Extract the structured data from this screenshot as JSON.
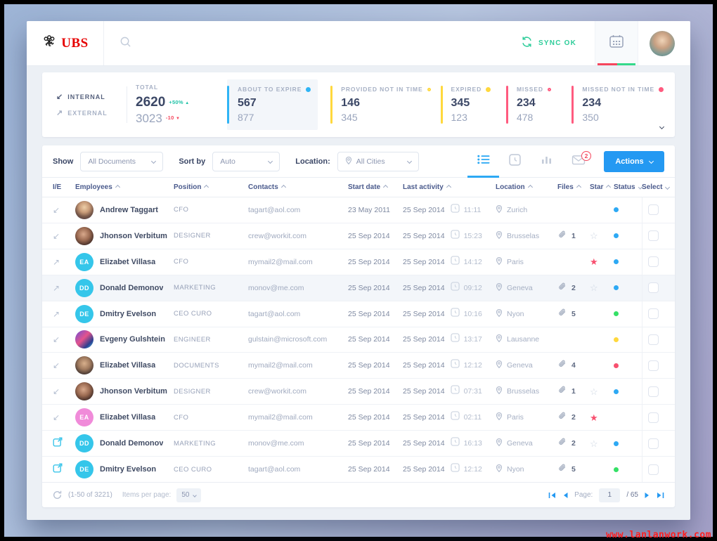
{
  "colors": {
    "accent_blue": "#2499f2",
    "ubs_red": "#e60000",
    "sync_green": "#2ecd9a",
    "star": "#f8506f",
    "status": {
      "blue": "#2da9f4",
      "green": "#35e066",
      "yellow": "#ffd83d",
      "pink": "#f8506f"
    },
    "initials": {
      "cyan": "#35c6ea",
      "pink": "#f08bd9"
    }
  },
  "glyphs": {
    "arrow_in": "↙",
    "arrow_out": "↗",
    "star_filled": "★",
    "star_empty": "☆"
  },
  "header": {
    "brand": "UBS",
    "sync_label": "SYNC OK"
  },
  "stats": {
    "internal_label": "INTERNAL",
    "external_label": "EXTERNAL",
    "total": {
      "label": "TOTAL",
      "internal": "2620",
      "internal_delta": "+50%",
      "external": "3023",
      "external_delta": "-10"
    },
    "cards": [
      {
        "label": "ABOUT TO EXPIRE",
        "internal": "567",
        "external": "877",
        "accent": "#2fb4f5",
        "dot": "filled",
        "highlighted": true
      },
      {
        "label": "PROVIDED NOT IN TIME",
        "internal": "146",
        "external": "345",
        "accent": "#ffd83d",
        "dot": "outline",
        "highlighted": false
      },
      {
        "label": "EXPIRED",
        "internal": "345",
        "external": "123",
        "accent": "#ffd83d",
        "dot": "filled",
        "highlighted": false
      },
      {
        "label": "MISSED",
        "internal": "234",
        "external": "478",
        "accent": "#ff5b7f",
        "dot": "outline",
        "highlighted": false
      },
      {
        "label": "MISSED NOT IN TIME",
        "internal": "234",
        "external": "350",
        "accent": "#ff5b7f",
        "dot": "filled",
        "highlighted": false
      }
    ]
  },
  "toolbar": {
    "show_label": "Show",
    "show_value": "All Documents",
    "sort_label": "Sort by",
    "sort_value": "Auto",
    "location_label": "Location:",
    "location_value": "All Cities",
    "mail_badge": "2",
    "actions_label": "Actions"
  },
  "table": {
    "columns": [
      {
        "label": "I/E",
        "sort": ""
      },
      {
        "label": "Employees",
        "sort": "up"
      },
      {
        "label": "Position",
        "sort": "up"
      },
      {
        "label": "Contacts",
        "sort": "up"
      },
      {
        "label": "Start date",
        "sort": "up"
      },
      {
        "label": "Last activity",
        "sort": "up"
      },
      {
        "label": "Location",
        "sort": "up"
      },
      {
        "label": "Files",
        "sort": "up"
      },
      {
        "label": "Star",
        "sort": "up"
      },
      {
        "label": "Status",
        "sort": "down"
      },
      {
        "label": "Select",
        "sort": "down"
      }
    ],
    "rows": [
      {
        "ie": "in",
        "avatar": {
          "kind": "photo",
          "style": "p1"
        },
        "name": "Andrew Taggart",
        "position": "CFO",
        "contact": "tagart@aol.com",
        "start": "23 May 2011",
        "adate": "25 Sep 2014",
        "atime": "11:11",
        "location": "Zurich",
        "files": "",
        "star": "",
        "status": "blue",
        "highlighted": false
      },
      {
        "ie": "in",
        "avatar": {
          "kind": "photo",
          "style": "p2"
        },
        "name": "Jhonson Verbitum",
        "position": "DESIGNER",
        "contact": "crew@workit.com",
        "start": "25 Sep 2014",
        "adate": "25 Sep 2014",
        "atime": "15:23",
        "location": "Brusselas",
        "files": "1",
        "star": "empty",
        "status": "blue",
        "highlighted": false
      },
      {
        "ie": "out",
        "avatar": {
          "kind": "initials",
          "text": "EA",
          "color": "cyan"
        },
        "name": "Elizabet Villasa",
        "position": "CFO",
        "contact": "mymail2@mail.com",
        "start": "25 Sep 2014",
        "adate": "25 Sep 2014",
        "atime": "14:12",
        "location": "Paris",
        "files": "",
        "star": "filled",
        "status": "blue",
        "highlighted": false
      },
      {
        "ie": "out",
        "avatar": {
          "kind": "initials",
          "text": "DD",
          "color": "cyan"
        },
        "name": "Donald Demonov",
        "position": "MARKETING",
        "contact": "monov@me.com",
        "start": "25 Sep 2014",
        "adate": "25 Sep 2014",
        "atime": "09:12",
        "location": "Geneva",
        "files": "2",
        "star": "empty",
        "status": "blue",
        "highlighted": true
      },
      {
        "ie": "out",
        "avatar": {
          "kind": "initials",
          "text": "DE",
          "color": "cyan"
        },
        "name": "Dmitry Evelson",
        "position": "CEO CURO",
        "contact": "tagart@aol.com",
        "start": "25 Sep 2014",
        "adate": "25 Sep 2014",
        "atime": "10:16",
        "location": "Nyon",
        "files": "5",
        "star": "",
        "status": "green",
        "highlighted": false
      },
      {
        "ie": "in",
        "avatar": {
          "kind": "photo",
          "style": "p3"
        },
        "name": "Evgeny Gulshtein",
        "position": "ENGINEER",
        "contact": "gulstain@microsoft.com",
        "start": "25 Sep 2014",
        "adate": "25 Sep 2014",
        "atime": "13:17",
        "location": "Lausanne",
        "files": "",
        "star": "",
        "status": "yellow",
        "highlighted": false
      },
      {
        "ie": "in",
        "avatar": {
          "kind": "photo",
          "style": "p4"
        },
        "name": "Elizabet Villasa",
        "position": "DOCUMENTS",
        "contact": "mymail2@mail.com",
        "start": "25 Sep 2014",
        "adate": "25 Sep 2014",
        "atime": "12:12",
        "location": "Geneva",
        "files": "4",
        "star": "",
        "status": "pink",
        "highlighted": false
      },
      {
        "ie": "in",
        "avatar": {
          "kind": "photo",
          "style": "p2"
        },
        "name": "Jhonson Verbitum",
        "position": "DESIGNER",
        "contact": "crew@workit.com",
        "start": "25 Sep 2014",
        "adate": "25 Sep 2014",
        "atime": "07:31",
        "location": "Brusselas",
        "files": "1",
        "star": "empty",
        "status": "blue",
        "highlighted": false
      },
      {
        "ie": "in",
        "avatar": {
          "kind": "initials",
          "text": "EA",
          "color": "pink"
        },
        "name": "Elizabet Villasa",
        "position": "CFO",
        "contact": "mymail2@mail.com",
        "start": "25 Sep 2014",
        "adate": "25 Sep 2014",
        "atime": "02:11",
        "location": "Paris",
        "files": "2",
        "star": "filled",
        "status": "",
        "highlighted": false
      },
      {
        "ie": "link",
        "avatar": {
          "kind": "initials",
          "text": "DD",
          "color": "cyan"
        },
        "name": "Donald Demonov",
        "position": "MARKETING",
        "contact": "monov@me.com",
        "start": "25 Sep 2014",
        "adate": "25 Sep 2014",
        "atime": "16:13",
        "location": "Geneva",
        "files": "2",
        "star": "empty",
        "status": "blue",
        "highlighted": false
      },
      {
        "ie": "link",
        "avatar": {
          "kind": "initials",
          "text": "DE",
          "color": "cyan"
        },
        "name": "Dmitry Evelson",
        "position": "CEO CURO",
        "contact": "tagart@aol.com",
        "start": "25 Sep 2014",
        "adate": "25 Sep 2014",
        "atime": "12:12",
        "location": "Nyon",
        "files": "5",
        "star": "",
        "status": "green",
        "highlighted": false
      }
    ]
  },
  "footer": {
    "range": "(1-50 of 3221)",
    "per_page_label": "Items per page:",
    "per_page_value": "50",
    "page_label": "Page:",
    "page_value": "1",
    "page_total": "/ 65"
  },
  "watermark": "www.lanlanwork.com"
}
